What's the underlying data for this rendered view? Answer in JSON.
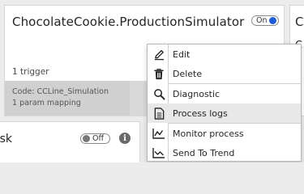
{
  "card": {
    "title": "ChocolateCookie.ProductionSimulator",
    "toggle_label": "On",
    "trigger_text": "1 trigger",
    "code_text": "Code: CCLine_Simulation",
    "mapping_text": "1 param mapping"
  },
  "right_card": {
    "title": "Co",
    "sub": "C"
  },
  "lower_card": {
    "title": "ask",
    "toggle_label": "Off",
    "info_glyph": "i"
  },
  "menu": {
    "items": [
      {
        "label": "Edit",
        "icon": "pencil-icon"
      },
      {
        "label": "Delete",
        "icon": "trash-icon"
      },
      {
        "label": "Diagnostic",
        "icon": "search-icon"
      },
      {
        "label": "Process logs",
        "icon": "document-icon"
      },
      {
        "label": "Monitor process",
        "icon": "line-chart-icon"
      },
      {
        "label": "Send To Trend",
        "icon": "trend-chart-icon"
      }
    ]
  },
  "colors": {
    "toggle_on_knob": "#1f5ed6",
    "status_ok": "#3bb54a",
    "menu_highlight": "#e8e8e8"
  }
}
